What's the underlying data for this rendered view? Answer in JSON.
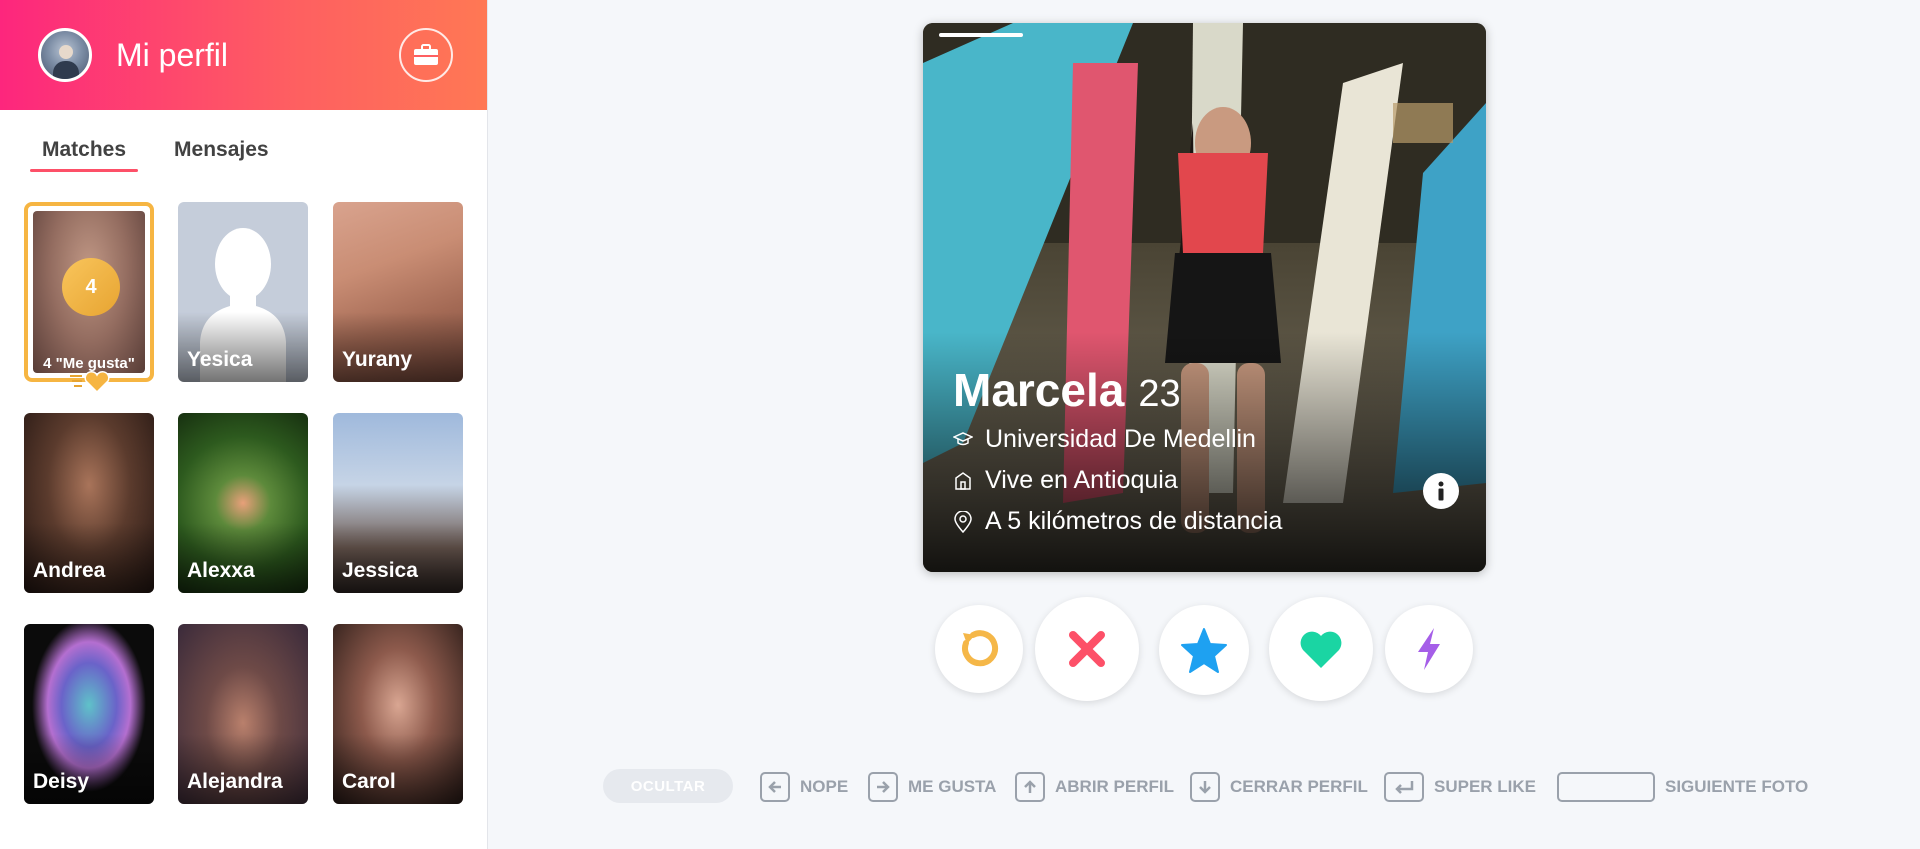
{
  "header": {
    "title": "Mi perfil"
  },
  "tabs": [
    {
      "label": "Matches"
    },
    {
      "label": "Mensajes"
    }
  ],
  "likes": {
    "count": "4",
    "label": "4 \"Me gusta\""
  },
  "matches": [
    {
      "name": "Yesica",
      "bg": "linear-gradient(180deg,#c9d1de,#b7c1d1)",
      "placeholder": true
    },
    {
      "name": "Yurany",
      "bg": "linear-gradient(160deg,#d9a38e 0%,#c98d74 35%,#a46a55 65%,#7d4c3e 100%)"
    },
    {
      "name": "Andrea",
      "bg": "radial-gradient(ellipse at 50% 40%,#a9745a 0%,#5b3b2d 45%,#241612 100%)"
    },
    {
      "name": "Alexxa",
      "bg": "radial-gradient(circle at 50% 50%,#e8a07a 0%,#5d8a3b 25%,#2d5a1e 60%,#173010 100%)"
    },
    {
      "name": "Jessica",
      "bg": "linear-gradient(180deg,#9fb9dc 0%,#c6d4e6 40%,#6c5a52 75%,#2f2623 100%)"
    },
    {
      "name": "Deisy",
      "bg": "radial-gradient(ellipse at 50% 45%,#5fc2c9 0%,#6a63c9 30%,#b46fd0 45%,#0b0b0b 62%)"
    },
    {
      "name": "Alejandra",
      "bg": "radial-gradient(ellipse at 50% 55%,#b9806c 0%,#6e4a47 40%,#3a2a3a 100%)"
    },
    {
      "name": "Carol",
      "bg": "radial-gradient(ellipse at 50% 45%,#d9a692 0%,#8d5a4c 40%,#2b1c18 100%)"
    }
  ],
  "profile": {
    "name": "Marcela",
    "age": "23",
    "school": "Universidad De Medellin",
    "lives": "Vive en Antioquia",
    "distance": "A 5 kilómetros de distancia"
  },
  "actions": [
    {
      "name": "rewind",
      "color": "#f5b748"
    },
    {
      "name": "nope",
      "color": "#fd5068"
    },
    {
      "name": "super-like",
      "color": "#1ea1f1"
    },
    {
      "name": "like",
      "color": "#1ad5a3"
    },
    {
      "name": "boost",
      "color": "#a55ee8"
    }
  ],
  "hints": {
    "hide": "OCULTAR",
    "nope": "NOPE",
    "like": "ME GUSTA",
    "open": "ABRIR PERFIL",
    "close": "CERRAR PERFIL",
    "superlike": "SUPER LIKE",
    "next": "SIGUIENTE FOTO"
  }
}
